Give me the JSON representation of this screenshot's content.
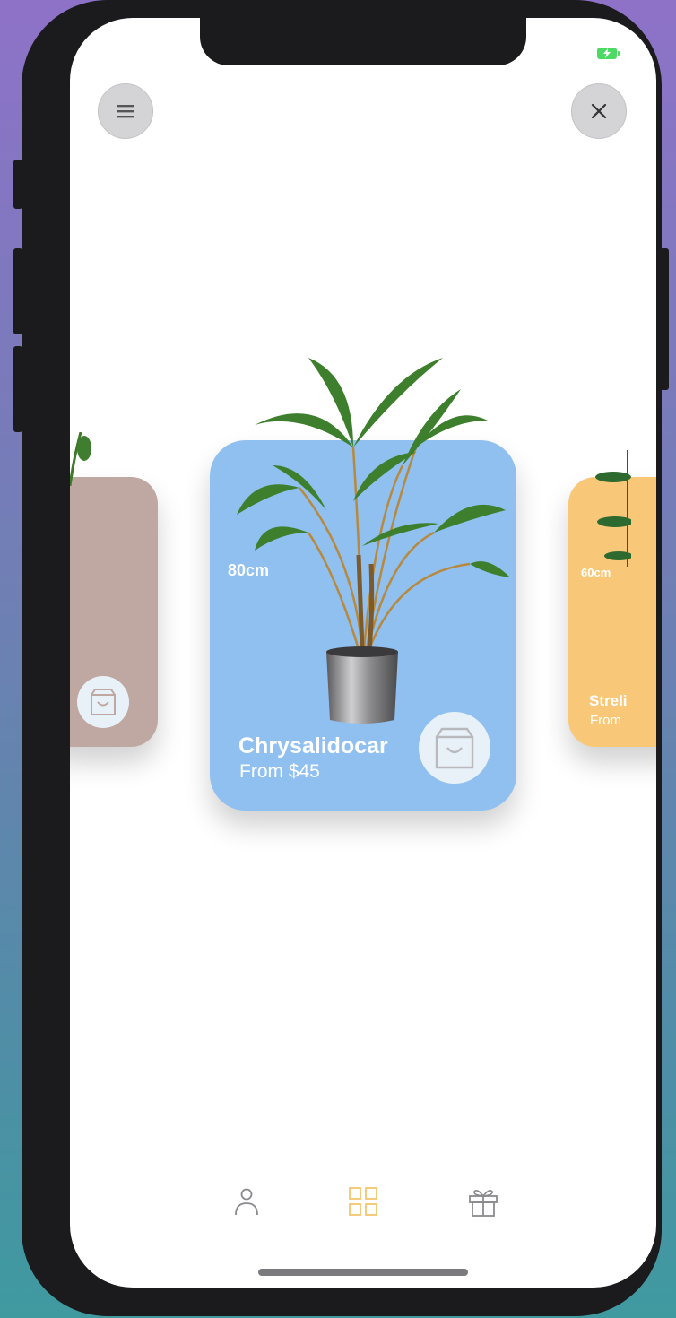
{
  "header": {
    "menu_icon": "menu-icon",
    "close_icon": "close-icon"
  },
  "status_bar": {
    "battery": "battery-charging-icon"
  },
  "carousel": {
    "main": {
      "size": "80cm",
      "name": "Chrysalidocar",
      "price": "From $45",
      "color": "#8fc0f0"
    },
    "left": {
      "size": "",
      "name": "",
      "price": "",
      "color": "#bfa8a2"
    },
    "right": {
      "size": "60cm",
      "name": "Streli",
      "price": "From",
      "color": "#f8c878"
    }
  },
  "tabbar": {
    "items": [
      {
        "icon": "profile-icon",
        "active": false
      },
      {
        "icon": "grid-icon",
        "active": true,
        "color": "#f5c56e"
      },
      {
        "icon": "gift-icon",
        "active": false
      }
    ]
  }
}
